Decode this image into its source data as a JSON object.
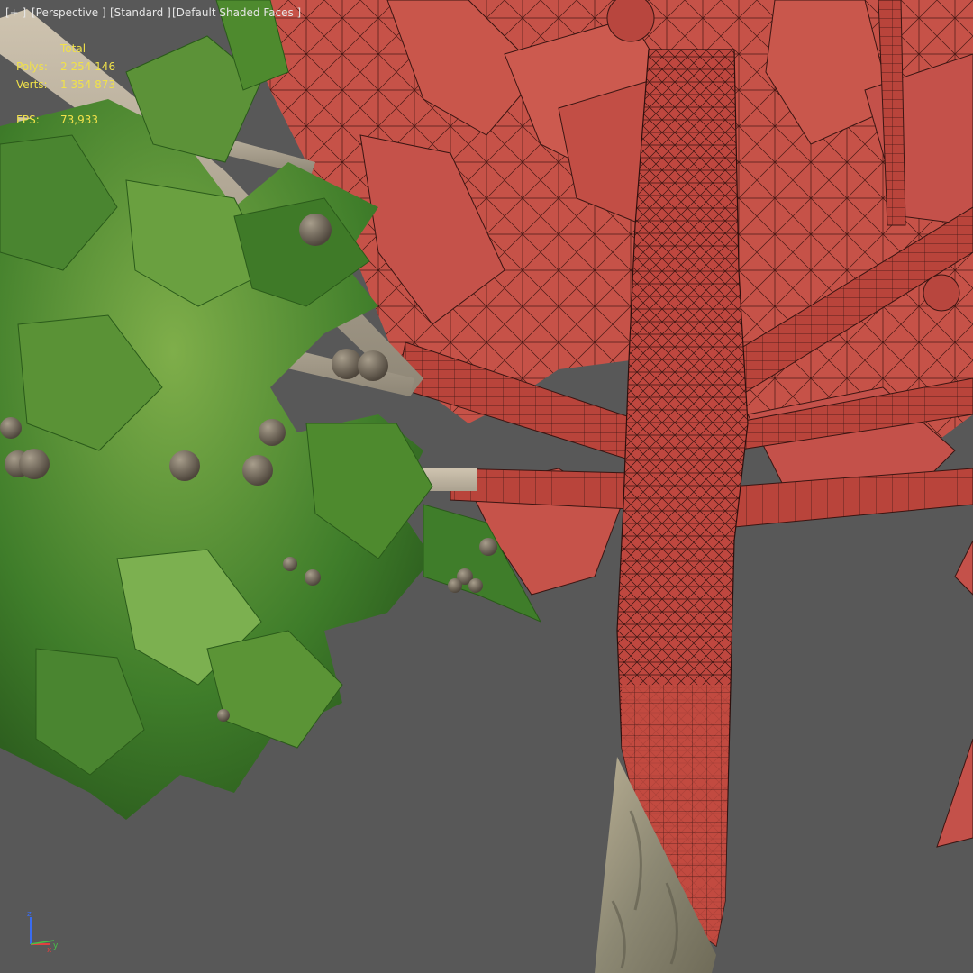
{
  "viewport_menu": {
    "plus": "[+ ]",
    "view": "[Perspective ]",
    "shading_mode": "[Standard ]",
    "display": "[Default Shaded Faces ]"
  },
  "statistics": {
    "header": "Total",
    "polys_label": "Polys:",
    "polys_value": "2 254 146",
    "verts_label": "Verts:",
    "verts_value": "1 354 873",
    "fps_label": "FPS:",
    "fps_value": "73,933"
  },
  "axis_gizmo": {
    "z": "z",
    "x": "x",
    "y": "y"
  },
  "colors": {
    "viewport_bg": "#585858",
    "stats_text": "#f0e14a",
    "menu_text": "#e6e6e6",
    "wireframe_red": "#c0483f",
    "foliage_green": "#3f7d2a"
  }
}
